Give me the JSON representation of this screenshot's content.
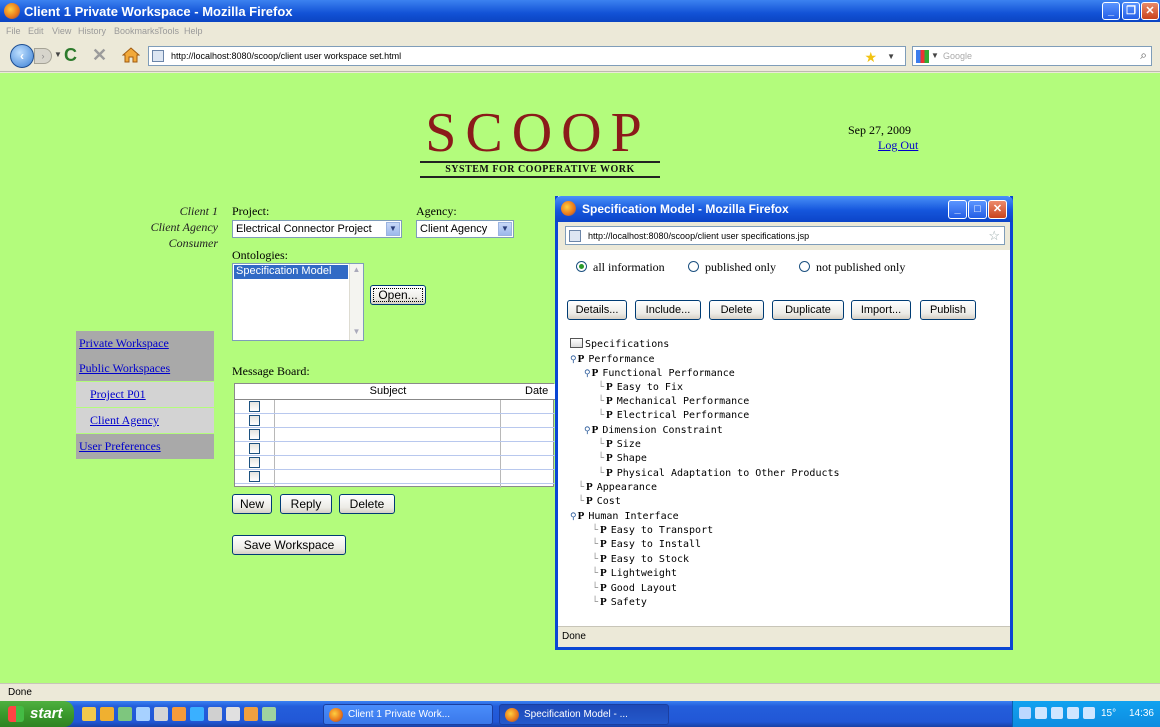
{
  "browser": {
    "title": "Client 1 Private Workspace - Mozilla Firefox",
    "menu": [
      "File",
      "Edit",
      "View",
      "History",
      "Bookmarks",
      "Tools",
      "Help"
    ],
    "url": "http://localhost:8080/scoop/client user workspace set.html",
    "search_placeholder": "Google",
    "status": "Done"
  },
  "page": {
    "logo": "SCOOP",
    "logo_subtitle": "SYSTEM FOR COOPERATIVE WORK",
    "date": "Sep 27, 2009",
    "logout": "Log Out",
    "user": {
      "name": "Client 1",
      "agency": "Client Agency",
      "role": "Consumer"
    },
    "project_label": "Project:",
    "project_value": "Electrical Connector Project",
    "agency_label": "Agency:",
    "agency_value": "Client Agency",
    "ontologies_label": "Ontologies:",
    "ontologies_selected": "Specification Model",
    "open_button": "Open...",
    "nav": {
      "private_workspace": "Private Workspace",
      "public_workspaces": "Public Workspaces",
      "project_p01": "Project P01",
      "client_agency": "Client Agency",
      "user_preferences": "User Preferences"
    },
    "message_board_label": "Message Board:",
    "message_columns": [
      "Subject",
      "Date"
    ],
    "message_rows": 6,
    "new_button": "New",
    "reply_button": "Reply",
    "delete_button": "Delete",
    "save_button": "Save Workspace"
  },
  "popup": {
    "title": "Specification Model - Mozilla Firefox",
    "url": "http://localhost:8080/scoop/client user specifications.jsp",
    "radio_all": "all information",
    "radio_published": "published only",
    "radio_not_published": "not published only",
    "buttons": {
      "details": "Details...",
      "include": "Include...",
      "delete": "Delete",
      "duplicate": "Duplicate",
      "import": "Import...",
      "publish": "Publish"
    },
    "tree": {
      "root": "Specifications",
      "performance": "Performance",
      "functional_performance": "Functional Performance",
      "easy_to_fix": "Easy to Fix",
      "mechanical_performance": "Mechanical Performance",
      "electrical_performance": "Electrical Performance",
      "dimension_constraint": "Dimension Constraint",
      "size": "Size",
      "shape": "Shape",
      "physical_adaptation": "Physical Adaptation to Other Products",
      "appearance": "Appearance",
      "cost": "Cost",
      "human_interface": "Human Interface",
      "easy_to_transport": "Easy to Transport",
      "easy_to_install": "Easy to Install",
      "easy_to_stock": "Easy to Stock",
      "lightweight": "Lightweight",
      "good_layout": "Good Layout",
      "safety": "Safety",
      "p_marker": "P"
    },
    "status": "Done"
  },
  "taskbar": {
    "start": "start",
    "task1": "Client 1 Private Work...",
    "task2": "Specification Model - ...",
    "temp": "15°",
    "clock": "14:36"
  }
}
